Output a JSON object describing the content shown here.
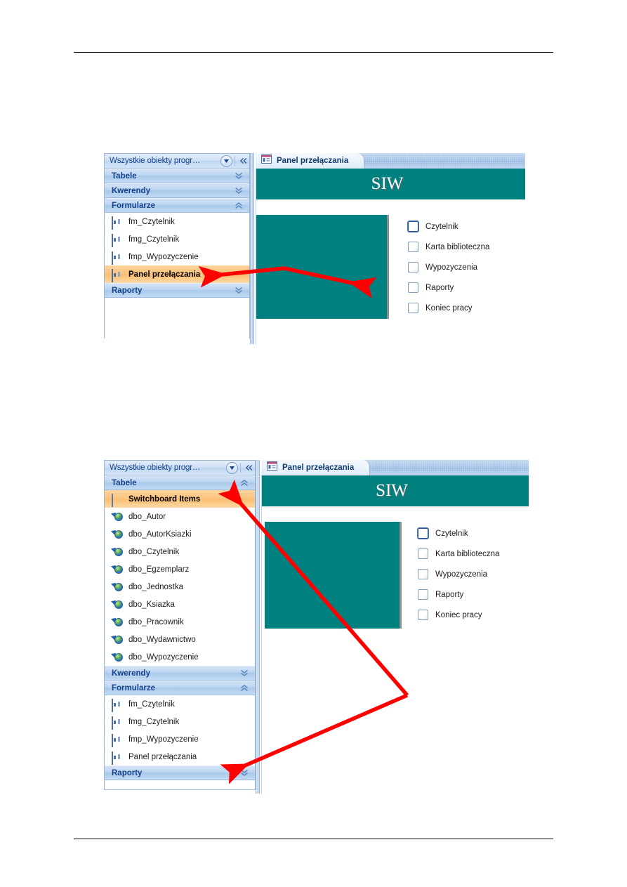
{
  "page": {
    "rules": [
      "top-horizontal-rule",
      "bottom-horizontal-rule"
    ]
  },
  "colors": {
    "teal_form": "#00807f",
    "selection_orange": "#fbc27c",
    "nav_blue": "#bcd5f0",
    "annotation_red": "#ff0000",
    "header_text_blue": "#15428b"
  },
  "figure_one": {
    "nav_pane": {
      "header": {
        "title": "Wszystkie obiekty progr…",
        "dropdown_icon": "chevron-down-icon",
        "collapse_icon": "double-chevron-left-icon"
      },
      "groups": [
        {
          "label": "Tabele",
          "state": "collapsed",
          "chevron": "double-chevron-down-icon",
          "items": []
        },
        {
          "label": "Kwerendy",
          "state": "collapsed",
          "chevron": "double-chevron-down-icon",
          "items": []
        },
        {
          "label": "Formularze",
          "state": "expanded",
          "chevron": "double-chevron-up-icon",
          "items": [
            {
              "label": "fm_Czytelnik",
              "icon": "form-icon",
              "selected": false
            },
            {
              "label": "fmg_Czytelnik",
              "icon": "form-icon",
              "selected": false
            },
            {
              "label": "fmp_Wypozyczenie",
              "icon": "form-icon",
              "selected": false
            },
            {
              "label": "Panel przełączania",
              "icon": "form-icon",
              "selected": true
            }
          ]
        },
        {
          "label": "Raporty",
          "state": "collapsed",
          "chevron": "double-chevron-down-icon",
          "items": []
        }
      ]
    },
    "document": {
      "tab": {
        "label": "Panel przełączania",
        "icon": "form-icon"
      },
      "form": {
        "title": "SIW",
        "options": [
          {
            "label": "Czytelnik",
            "checked": false,
            "focused": true
          },
          {
            "label": "Karta biblioteczna",
            "checked": false,
            "focused": false
          },
          {
            "label": "Wypozyczenia",
            "checked": false,
            "focused": false
          },
          {
            "label": "Raporty",
            "checked": false,
            "focused": false
          },
          {
            "label": "Koniec pracy",
            "checked": false,
            "focused": false
          }
        ]
      }
    },
    "annotation": {
      "type": "double-headed-arrow",
      "description": "Links the selected Panel przełączania navigation item to the opened form."
    }
  },
  "figure_two": {
    "nav_pane": {
      "header": {
        "title": "Wszystkie obiekty progr…",
        "dropdown_icon": "chevron-down-icon",
        "collapse_icon": "double-chevron-left-icon"
      },
      "groups": [
        {
          "label": "Tabele",
          "state": "expanded",
          "chevron": "double-chevron-up-icon",
          "items": [
            {
              "label": "Switchboard Items",
              "icon": "table-icon",
              "selected": true
            },
            {
              "label": "dbo_Autor",
              "icon": "linked-table-icon",
              "selected": false
            },
            {
              "label": "dbo_AutorKsiazki",
              "icon": "linked-table-icon",
              "selected": false
            },
            {
              "label": "dbo_Czytelnik",
              "icon": "linked-table-icon",
              "selected": false
            },
            {
              "label": "dbo_Egzemplarz",
              "icon": "linked-table-icon",
              "selected": false
            },
            {
              "label": "dbo_Jednostka",
              "icon": "linked-table-icon",
              "selected": false
            },
            {
              "label": "dbo_Ksiazka",
              "icon": "linked-table-icon",
              "selected": false
            },
            {
              "label": "dbo_Pracownik",
              "icon": "linked-table-icon",
              "selected": false
            },
            {
              "label": "dbo_Wydawnictwo",
              "icon": "linked-table-icon",
              "selected": false
            },
            {
              "label": "dbo_Wypozyczenie",
              "icon": "linked-table-icon",
              "selected": false
            }
          ]
        },
        {
          "label": "Kwerendy",
          "state": "collapsed",
          "chevron": "double-chevron-down-icon",
          "items": []
        },
        {
          "label": "Formularze",
          "state": "expanded",
          "chevron": "double-chevron-up-icon",
          "items": [
            {
              "label": "fm_Czytelnik",
              "icon": "form-icon",
              "selected": false
            },
            {
              "label": "fmg_Czytelnik",
              "icon": "form-icon",
              "selected": false
            },
            {
              "label": "fmp_Wypozyczenie",
              "icon": "form-icon",
              "selected": false
            },
            {
              "label": "Panel przełączania",
              "icon": "form-icon",
              "selected": false
            }
          ]
        },
        {
          "label": "Raporty",
          "state": "collapsed",
          "chevron": "double-chevron-down-icon",
          "items": []
        }
      ]
    },
    "document": {
      "tab": {
        "label": "Panel przełączania",
        "icon": "form-icon"
      },
      "form": {
        "title": "SIW",
        "options": [
          {
            "label": "Czytelnik",
            "checked": false,
            "focused": true
          },
          {
            "label": "Karta biblioteczna",
            "checked": false,
            "focused": false
          },
          {
            "label": "Wypozyczenia",
            "checked": false,
            "focused": false
          },
          {
            "label": "Raporty",
            "checked": false,
            "focused": false
          },
          {
            "label": "Koniec pracy",
            "checked": false,
            "focused": false
          }
        ]
      }
    },
    "annotation": {
      "type": "double-headed-arrow",
      "description": "Links Switchboard Items table to the Panel przełączania form entry."
    }
  }
}
